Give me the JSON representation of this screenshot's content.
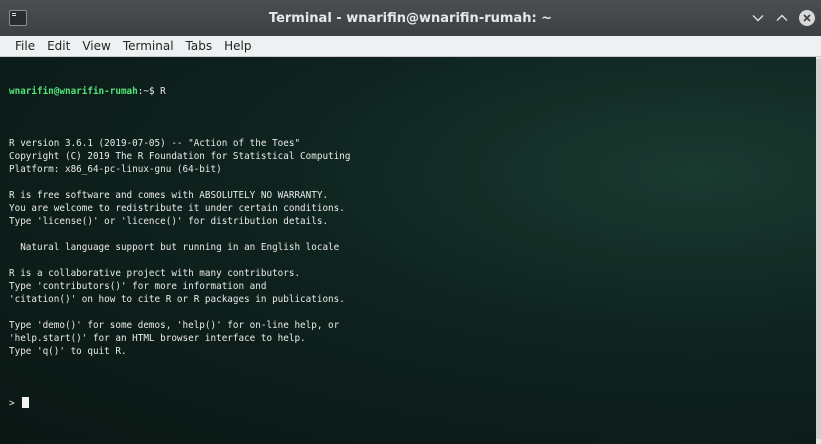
{
  "window": {
    "title": "Terminal - wnarifin@wnarifin-rumah: ~",
    "controls": [
      "minimize",
      "maximize",
      "close"
    ]
  },
  "menubar": {
    "items": [
      "File",
      "Edit",
      "View",
      "Terminal",
      "Tabs",
      "Help"
    ]
  },
  "terminal": {
    "prompt_user": "wnarifin@wnarifin-rumah",
    "prompt_path": ":~$ ",
    "command": "R",
    "output_lines": [
      "",
      "R version 3.6.1 (2019-07-05) -- \"Action of the Toes\"",
      "Copyright (C) 2019 The R Foundation for Statistical Computing",
      "Platform: x86_64-pc-linux-gnu (64-bit)",
      "",
      "R is free software and comes with ABSOLUTELY NO WARRANTY.",
      "You are welcome to redistribute it under certain conditions.",
      "Type 'license()' or 'licence()' for distribution details.",
      "",
      "  Natural language support but running in an English locale",
      "",
      "R is a collaborative project with many contributors.",
      "Type 'contributors()' for more information and",
      "'citation()' on how to cite R or R packages in publications.",
      "",
      "Type 'demo()' for some demos, 'help()' for on-line help, or",
      "'help.start()' for an HTML browser interface to help.",
      "Type 'q()' to quit R.",
      ""
    ],
    "r_prompt": "> "
  },
  "colors": {
    "prompt_user": "#53e37a",
    "terminal_text": "#eaeaea",
    "terminal_bg": "#0e221e",
    "titlebar_bg": "#3c4043"
  }
}
